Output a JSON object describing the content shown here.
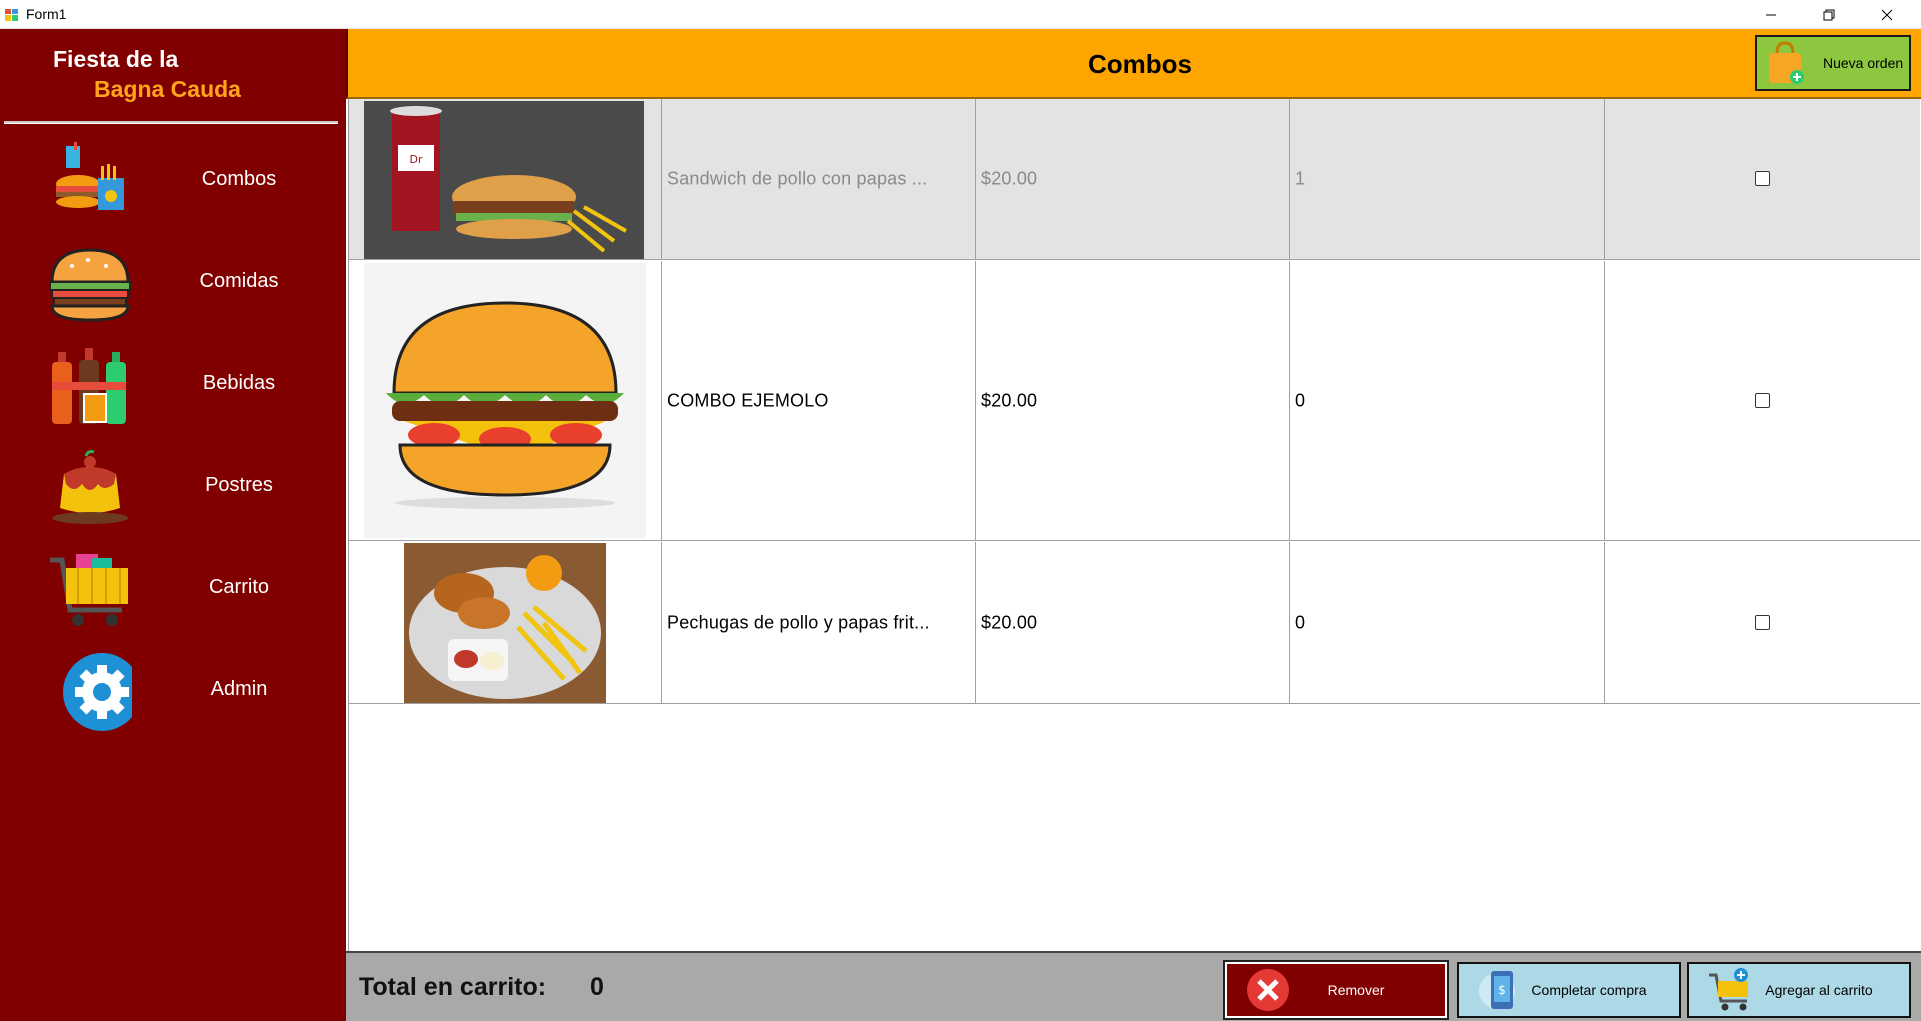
{
  "window": {
    "title": "Form1"
  },
  "sidebar": {
    "brand_line1": "Fiesta de la",
    "brand_line2": "Bagna Cauda",
    "items": [
      {
        "label": "Combos",
        "icon": "combo-meal-icon"
      },
      {
        "label": "Comidas",
        "icon": "burger-icon"
      },
      {
        "label": "Bebidas",
        "icon": "soda-bottles-icon"
      },
      {
        "label": "Postres",
        "icon": "flan-dessert-icon"
      },
      {
        "label": "Carrito",
        "icon": "shopping-cart-icon"
      },
      {
        "label": "Admin",
        "icon": "gear-icon"
      }
    ]
  },
  "header": {
    "title": "Combos",
    "new_order_label": "Nueva orden"
  },
  "grid": {
    "rows": [
      {
        "image": "soda-burger-fries-photo",
        "name": "Sandwich de pollo con papas ...",
        "price": "$20.00",
        "qty": "1",
        "checked": false,
        "selected": true
      },
      {
        "image": "burger-illustration",
        "name": "COMBO EJEMOLO",
        "price": "$20.00",
        "qty": "0",
        "checked": false,
        "selected": false
      },
      {
        "image": "chicken-fries-plate-photo",
        "name": "Pechugas de pollo y papas frit...",
        "price": "$20.00",
        "qty": "0",
        "checked": false,
        "selected": false
      }
    ]
  },
  "footer": {
    "total_label": "Total en carrito:",
    "total_value": "0",
    "remove_label": "Remover",
    "complete_label": "Completar compra",
    "add_label": "Agregar al carrito"
  },
  "colors": {
    "sidebar_bg": "#800000",
    "header_bg": "#ffa500",
    "brand_accent": "#ffa41b",
    "new_order_bg": "#8dc63f",
    "footer_bg": "#a9a9a9",
    "action_button_bg": "#add8e6"
  }
}
